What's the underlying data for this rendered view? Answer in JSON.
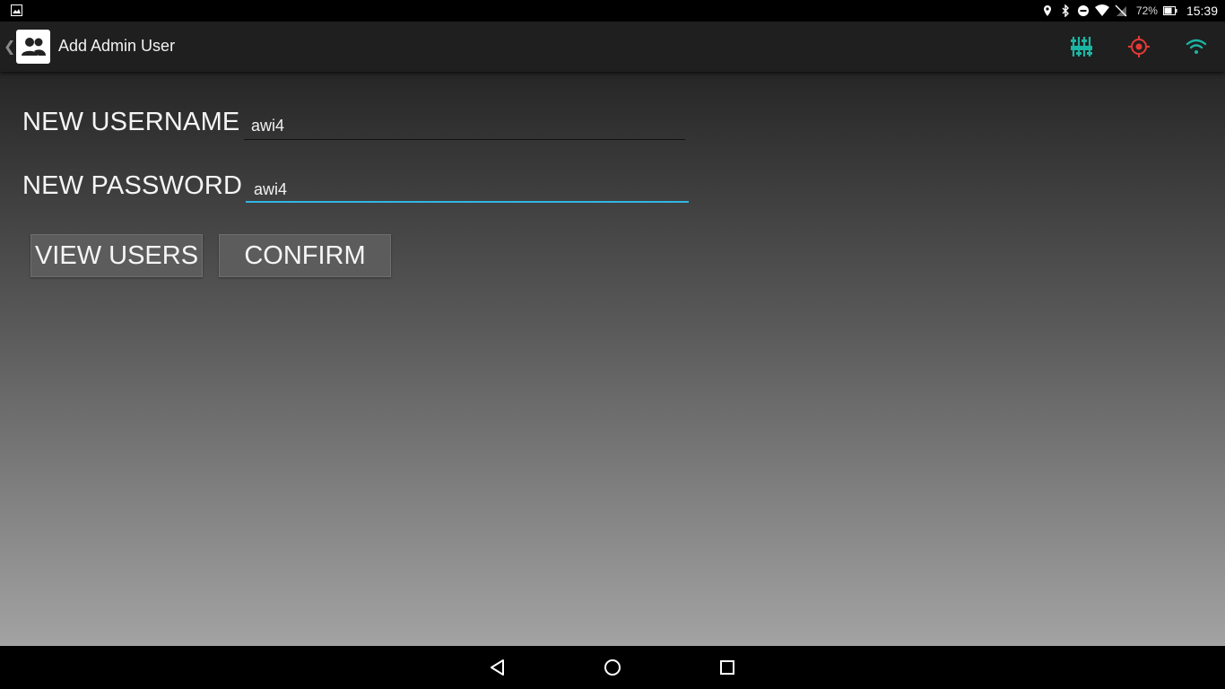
{
  "status_bar": {
    "notification_icon": "image-icon",
    "icons": [
      "location-icon",
      "bluetooth-icon",
      "do-not-disturb-icon",
      "wifi-signal-icon",
      "no-sim-icon"
    ],
    "battery_percent": "72%",
    "time": "15:39"
  },
  "action_bar": {
    "title": "Add Admin User",
    "app_icon": "people-icon",
    "actions": [
      {
        "name": "sliders-icon",
        "color": "#1bb5a3"
      },
      {
        "name": "target-icon",
        "color": "#e53935"
      },
      {
        "name": "wifi-icon",
        "color": "#1bb5a3"
      }
    ]
  },
  "form": {
    "username_label": "NEW USERNAME",
    "username_value": "awi4",
    "password_label": "NEW PASSWORD",
    "password_value": "awi4"
  },
  "buttons": {
    "view_users": "VIEW USERS",
    "confirm": "CONFIRM"
  },
  "colors": {
    "accent": "#1bb5a3",
    "focus_underline": "#33b5e5"
  }
}
